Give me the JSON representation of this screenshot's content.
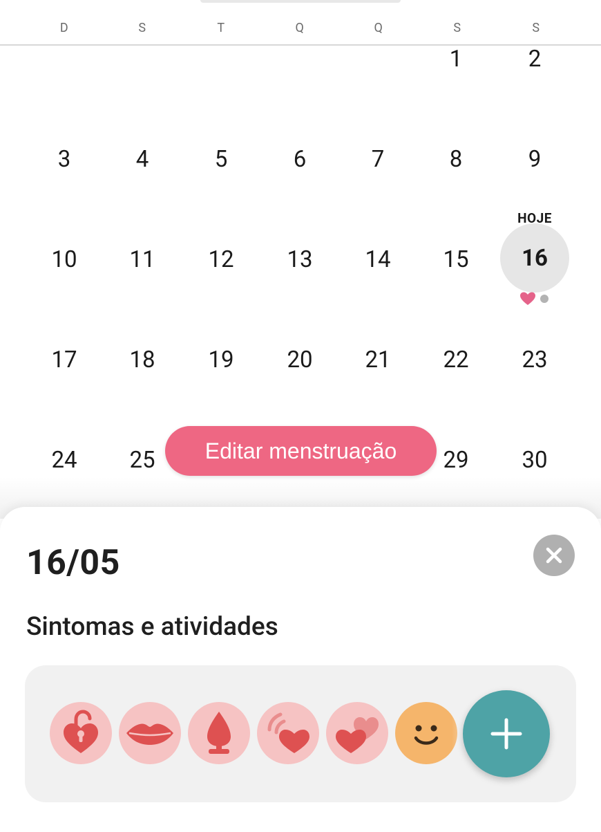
{
  "weekdays": [
    "D",
    "S",
    "T",
    "Q",
    "Q",
    "S",
    "S"
  ],
  "calendar": {
    "rows": [
      [
        "",
        "",
        "",
        "",
        "",
        "1",
        "2"
      ],
      [
        "3",
        "4",
        "5",
        "6",
        "7",
        "8",
        "9"
      ],
      [
        "10",
        "11",
        "12",
        "13",
        "14",
        "15",
        ""
      ],
      [
        "17",
        "18",
        "19",
        "20",
        "21",
        "22",
        "23"
      ],
      [
        "24",
        "25",
        "",
        "",
        "",
        "29",
        "30"
      ]
    ],
    "today_label": "HOJE",
    "today_day": "16"
  },
  "edit_button": {
    "label": "Editar menstruação"
  },
  "sheet": {
    "date": "16/05",
    "section_title": "Sintomas e atividades"
  },
  "colors": {
    "accent_pink": "#ee6783",
    "icon_bg": "#f6c3c3",
    "icon_red": "#de5151",
    "fab_teal": "#4ea3a6",
    "close_gray": "#b0b0b0"
  },
  "icons": [
    "heart-lock-icon",
    "lips-icon",
    "plug-icon",
    "heart-vibration-icon",
    "double-heart-icon",
    "smile-icon",
    "plus-icon",
    "close-icon"
  ]
}
